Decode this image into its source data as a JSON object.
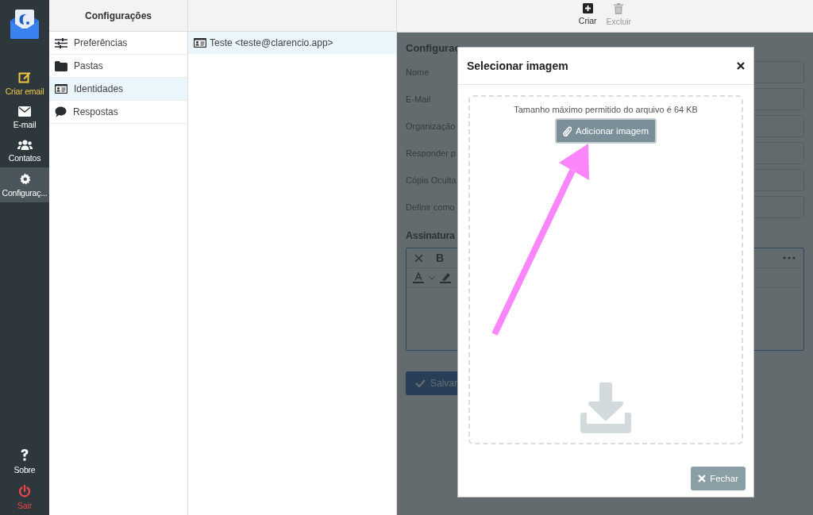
{
  "sidebar": {
    "items": [
      {
        "label": "Criar email",
        "color": "#f2c744",
        "selected": false
      },
      {
        "label": "E-mail",
        "color": "#ffffff",
        "selected": false
      },
      {
        "label": "Contatos",
        "color": "#ffffff",
        "selected": false
      },
      {
        "label": "Configuraç...",
        "color": "#ffffff",
        "selected": true
      }
    ],
    "bottom_items": [
      {
        "label": "Sobre",
        "color": "#ffffff"
      },
      {
        "label": "Sair",
        "color": "#f0474a"
      }
    ]
  },
  "settings_menu": {
    "title": "Configurações",
    "items": [
      {
        "label": "Preferências",
        "selected": false
      },
      {
        "label": "Pastas",
        "selected": false
      },
      {
        "label": "Identidades",
        "selected": true
      },
      {
        "label": "Respostas",
        "selected": false
      }
    ]
  },
  "identities": [
    {
      "label": "Teste <teste@clarencio.app>",
      "selected": true
    }
  ],
  "toolbar": [
    {
      "label": "Criar",
      "disabled": false
    },
    {
      "label": "Excluir",
      "disabled": true
    }
  ],
  "identity_form": {
    "title": "Configuraç",
    "fields": [
      "Nome",
      "E-Mail",
      "Organização",
      "Responder p",
      "Cópia Oculta",
      "Definir como"
    ],
    "signature_title": "Assinatura",
    "editor_buttons": [
      "B"
    ],
    "save_button": "Salvar"
  },
  "modal": {
    "title": "Selecionar imagem",
    "hint": "Tamanho máximo permitido do arquivo é 64 KB",
    "add_button": "Adicionar imagem",
    "close_button": "Fechar"
  }
}
